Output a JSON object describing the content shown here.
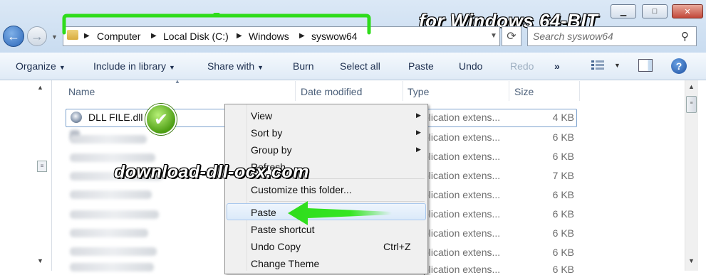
{
  "window": {
    "min_label": "▁",
    "max_label": "□",
    "close_label": "✕"
  },
  "banner": "for Windows 64-BIT",
  "address": {
    "crumbs": [
      "Computer",
      "Local Disk (C:)",
      "Windows",
      "syswow64"
    ],
    "search_placeholder": "Search syswow64"
  },
  "toolbar": {
    "organize": "Organize",
    "include": "Include in library",
    "share": "Share with",
    "burn": "Burn",
    "select_all": "Select all",
    "paste": "Paste",
    "undo": "Undo",
    "redo": "Redo",
    "more": "»"
  },
  "columns": {
    "name": "Name",
    "date": "Date modified",
    "type": "Type",
    "size": "Size"
  },
  "file": {
    "name": "DLL FILE.dll"
  },
  "rows": [
    {
      "type": "plication extens...",
      "size": "4 KB"
    },
    {
      "type": "plication extens...",
      "size": "6 KB"
    },
    {
      "type": "plication extens...",
      "size": "6 KB"
    },
    {
      "type": "plication extens...",
      "size": "7 KB"
    },
    {
      "type": "plication extens...",
      "size": "6 KB"
    },
    {
      "type": "plication extens...",
      "size": "6 KB"
    },
    {
      "type": "plication extens...",
      "size": "6 KB"
    },
    {
      "type": "plication extens...",
      "size": "6 KB"
    },
    {
      "type": "plication extens...",
      "size": "6 KB"
    }
  ],
  "watermark": "download-dll-ocx.com",
  "menu": {
    "view": "View",
    "sort_by": "Sort by",
    "group_by": "Group by",
    "refresh": "Refresh",
    "customize": "Customize this folder...",
    "paste": "Paste",
    "paste_shortcut": "Paste shortcut",
    "undo_copy": "Undo Copy",
    "undo_copy_shortcut": "Ctrl+Z",
    "change_theme": "Change Theme"
  },
  "icons": {
    "back": "back-arrow-icon",
    "forward": "forward-arrow-icon",
    "refresh": "refresh-icon",
    "search": "search-icon",
    "help": "help-icon",
    "check": "checkmark-icon",
    "arrow": "green-pointer-arrow"
  },
  "colors": {
    "highlight_green": "#2fdc1c",
    "accent_blue": "#2a66b8"
  }
}
